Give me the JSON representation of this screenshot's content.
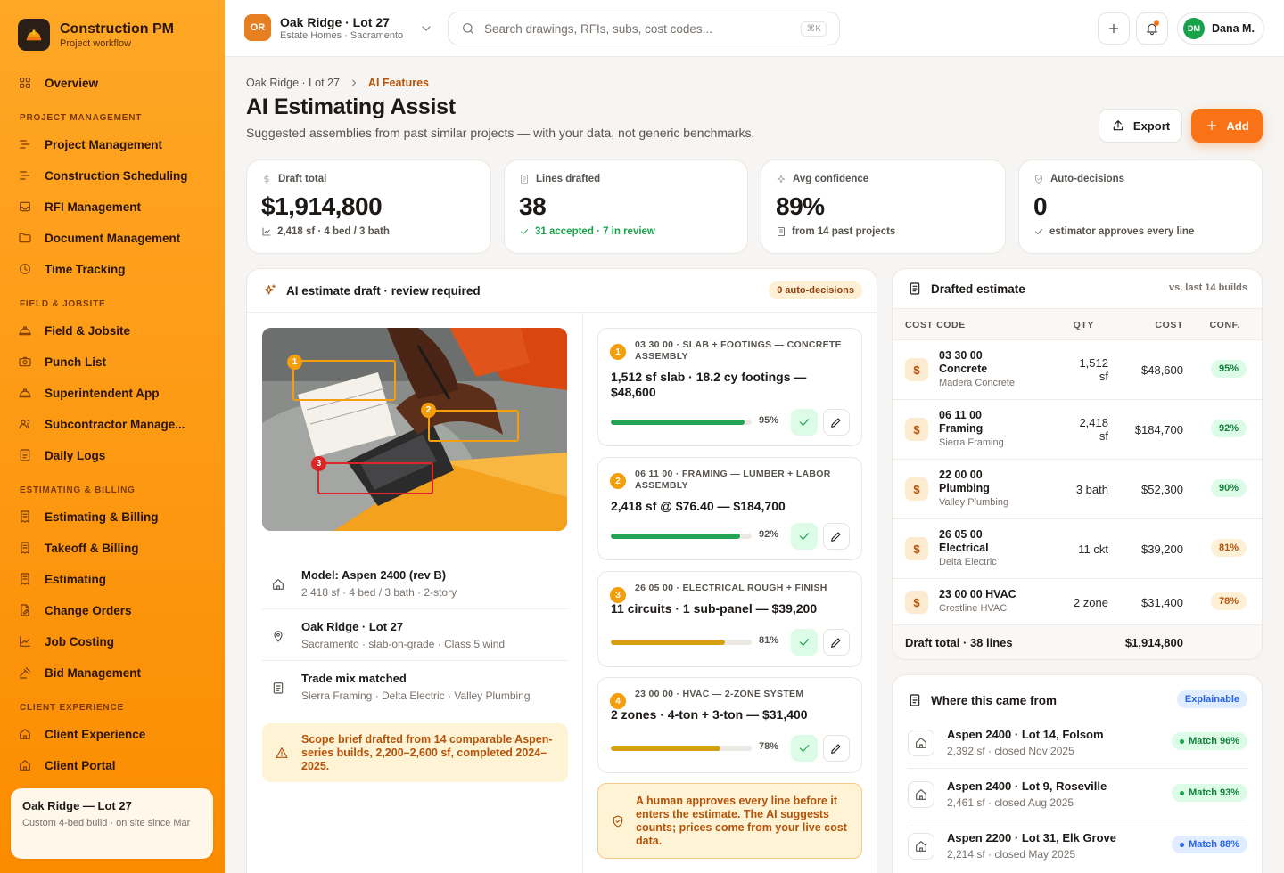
{
  "brand": {
    "title": "Construction PM",
    "subtitle": "Project workflow"
  },
  "sidebar": {
    "overview": "Overview",
    "sections": {
      "project_management": "PROJECT MANAGEMENT",
      "field": "FIELD & JOBSITE",
      "estimating": "ESTIMATING & BILLING",
      "client": "CLIENT EXPERIENCE"
    },
    "pm_items": [
      "Project Management",
      "Construction Scheduling",
      "RFI Management",
      "Document Management",
      "Time Tracking"
    ],
    "field_items": [
      "Field & Jobsite",
      "Punch List",
      "Superintendent App",
      "Subcontractor Manage...",
      "Daily Logs"
    ],
    "est_items": [
      "Estimating & Billing",
      "Takeoff & Billing",
      "Estimating",
      "Change Orders",
      "Job Costing",
      "Bid Management"
    ],
    "client_items": [
      "Client Experience",
      "Client Portal"
    ],
    "project_card": {
      "title": "Oak Ridge — Lot 27",
      "subtitle": "Custom 4-bed build · on site since Mar"
    }
  },
  "topbar": {
    "project_initials": "OR",
    "project_name": "Oak Ridge · Lot 27",
    "project_org": "Estate Homes · Sacramento",
    "search_placeholder": "Search drawings, RFIs, subs, cost codes...",
    "search_kbd": "⌘K",
    "user_initials": "DM",
    "user_name": "Dana M."
  },
  "header": {
    "breadcrumb_parent": "Oak Ridge · Lot 27",
    "breadcrumb_current": "AI Features",
    "title": "AI Estimating Assist",
    "subtitle": "Suggested assemblies from past similar projects — with your data, not generic benchmarks.",
    "export_label": "Export",
    "add_label": "Add"
  },
  "stats": [
    {
      "label": "Draft total",
      "value": "$1,914,800",
      "sub": "2,418 sf · 4 bed / 3 bath",
      "icon": "dollar-icon",
      "sub_icon": "trend-icon"
    },
    {
      "label": "Lines drafted",
      "value": "38",
      "sub": "31 accepted · 7 in review",
      "icon": "document-icon",
      "sub_icon": "check-icon"
    },
    {
      "label": "Avg confidence",
      "value": "89%",
      "sub": "from 14 past projects",
      "icon": "sparkle-icon",
      "sub_icon": "file-icon"
    },
    {
      "label": "Auto-decisions",
      "value": "0",
      "sub": "estimator approves every line",
      "icon": "shield-check-icon",
      "sub_icon": "check-icon"
    }
  ],
  "draft": {
    "title": "AI estimate draft · review required",
    "badge": "0 auto-decisions",
    "markers": [
      "1",
      "2",
      "3"
    ],
    "meta": [
      {
        "title": "Model: Aspen 2400 (rev B)",
        "sub": "2,418 sf · 4 bed / 3 bath · 2-story",
        "icon": "house-icon"
      },
      {
        "title": "Oak Ridge · Lot 27",
        "sub": "Sacramento · slab-on-grade · Class 5 wind",
        "icon": "pin-icon"
      },
      {
        "title": "Trade mix matched",
        "sub": "Sierra Framing · Delta Electric · Valley Plumbing",
        "icon": "clipboard-icon"
      }
    ],
    "scope_note": "Scope brief drafted from 14 comparable Aspen-series builds, 2,200–2,600 sf, completed 2024–2025.",
    "suggestions": [
      {
        "num": "1",
        "code": "03 30 00 · SLAB + FOOTINGS — CONCRETE ASSEMBLY",
        "desc": "1,512 sf slab · 18.2 cy footings — $48,600",
        "confidence": 95,
        "confidence_label": "95%",
        "color": "#22a355"
      },
      {
        "num": "2",
        "code": "06 11 00 · FRAMING — LUMBER + LABOR ASSEMBLY",
        "desc": "2,418 sf @ $76.40 — $184,700",
        "confidence": 92,
        "confidence_label": "92%",
        "color": "#22a355"
      },
      {
        "num": "3",
        "code": "26 05 00 · ELECTRICAL ROUGH + FINISH",
        "desc": "11 circuits · 1 sub-panel — $39,200",
        "confidence": 81,
        "confidence_label": "81%",
        "color": "#d4a012"
      },
      {
        "num": "4",
        "code": "23 00 00 · HVAC — 2-ZONE SYSTEM",
        "desc": "2 zones · 4-ton + 3-ton — $31,400",
        "confidence": 78,
        "confidence_label": "78%",
        "color": "#d4a012"
      }
    ],
    "human_note": "A human approves every line before it enters the estimate. The AI suggests counts; prices come from your live cost data."
  },
  "estimate": {
    "title": "Drafted estimate",
    "compare": "vs. last 14 builds",
    "columns": [
      "COST CODE",
      "QTY",
      "COST",
      "CONF."
    ],
    "rows": [
      {
        "code": "03 30 00 Concrete",
        "vendor": "Madera Concrete",
        "qty": "1,512 sf",
        "cost": "$48,600",
        "conf": "95%",
        "level": "high"
      },
      {
        "code": "06 11 00 Framing",
        "vendor": "Sierra Framing",
        "qty": "2,418 sf",
        "cost": "$184,700",
        "conf": "92%",
        "level": "high"
      },
      {
        "code": "22 00 00 Plumbing",
        "vendor": "Valley Plumbing",
        "qty": "3 bath",
        "cost": "$52,300",
        "conf": "90%",
        "level": "high"
      },
      {
        "code": "26 05 00 Electrical",
        "vendor": "Delta Electric",
        "qty": "11 ckt",
        "cost": "$39,200",
        "conf": "81%",
        "level": "mid"
      },
      {
        "code": "23 00 00 HVAC",
        "vendor": "Crestline HVAC",
        "qty": "2 zone",
        "cost": "$31,400",
        "conf": "78%",
        "level": "mid"
      }
    ],
    "footer_label": "Draft total · 38 lines",
    "footer_total": "$1,914,800"
  },
  "sources": {
    "title": "Where this came from",
    "badge": "Explainable",
    "items": [
      {
        "title": "Aspen 2400 · Lot 14, Folsom",
        "sub": "2,392 sf · closed Nov 2025",
        "match": "Match 96%",
        "tone": "green"
      },
      {
        "title": "Aspen 2400 · Lot 9, Roseville",
        "sub": "2,461 sf · closed Aug 2025",
        "match": "Match 93%",
        "tone": "green"
      },
      {
        "title": "Aspen 2200 · Lot 31, Elk Grove",
        "sub": "2,214 sf · closed May 2025",
        "match": "Match 88%",
        "tone": "blue"
      }
    ]
  },
  "colors": {
    "accent": "#f97316",
    "sidebar": "#ffa726",
    "success": "#16a34a",
    "warning": "#d4a012"
  }
}
